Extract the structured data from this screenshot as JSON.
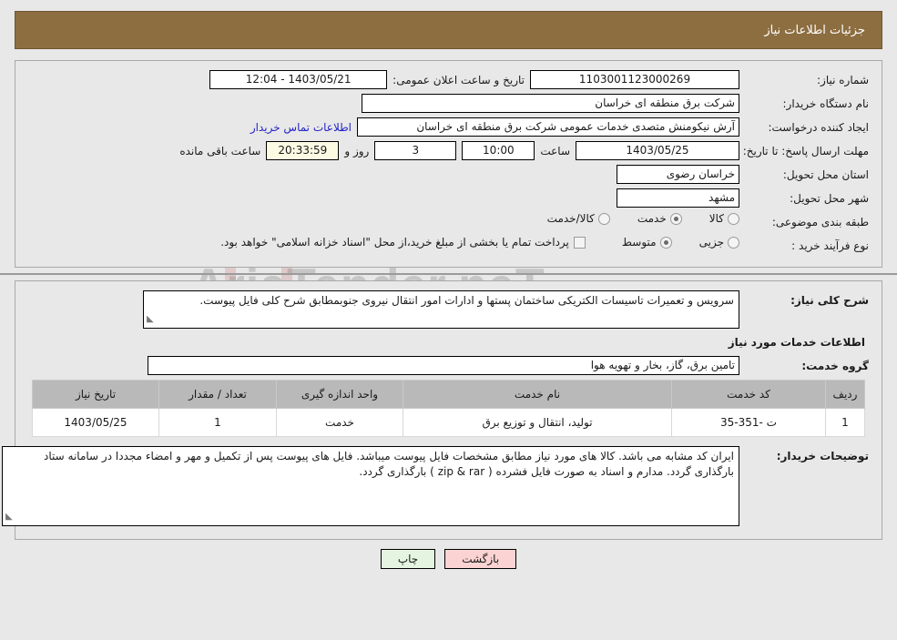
{
  "header": {
    "title": "جزئیات اطلاعات نیاز"
  },
  "watermark": {
    "text": "AriaTender.neT"
  },
  "form": {
    "need_number": {
      "label": "شماره نیاز:",
      "value": "1103001123000269"
    },
    "announce_datetime": {
      "label": "تاریخ و ساعت اعلان عمومی:",
      "value": "1403/05/21 - 12:04"
    },
    "buyer_org": {
      "label": "نام دستگاه خریدار:",
      "value": "شرکت برق منطقه ای خراسان"
    },
    "creator": {
      "label": "ایجاد کننده درخواست:",
      "value": "آرش نیکومنش متصدی خدمات عمومی شرکت برق منطقه ای خراسان",
      "contact_link": "اطلاعات تماس خریدار"
    },
    "deadline": {
      "label": "مهلت ارسال پاسخ: تا تاریخ:",
      "date": "1403/05/25",
      "time_label": "ساعت",
      "time": "10:00",
      "days": "3",
      "days_label": "روز و",
      "countdown": "20:33:59",
      "countdown_label": "ساعت باقی مانده"
    },
    "delivery_province": {
      "label": "استان محل تحویل:",
      "value": "خراسان رضوی"
    },
    "delivery_city": {
      "label": "شهر محل تحویل:",
      "value": "مشهد"
    },
    "category": {
      "label": "طبقه بندی موضوعی:",
      "options": [
        {
          "label": "کالا",
          "selected": false
        },
        {
          "label": "خدمت",
          "selected": true
        },
        {
          "label": "کالا/خدمت",
          "selected": false
        }
      ]
    },
    "purchase_type": {
      "label": "نوع فرآیند خرید :",
      "options": [
        {
          "label": "جزیی",
          "selected": false
        },
        {
          "label": "متوسط",
          "selected": true
        }
      ],
      "checkbox_label": "پرداخت تمام یا بخشی از مبلغ خرید،از محل \"اسناد خزانه اسلامی\" خواهد بود.",
      "checkbox_checked": false
    }
  },
  "description": {
    "label": "شرح کلی نیاز:",
    "value": "سرویس و تعمیرات تاسیسات الکتریکی ساختمان پستها و ادارات امور انتقال نیروی جنوبمطابق شرح کلی فایل پیوست."
  },
  "services_section": {
    "title": "اطلاعات خدمات مورد نیاز",
    "group": {
      "label": "گروه خدمت:",
      "value": "تامین برق، گاز، بخار و تهویه هوا"
    },
    "table": {
      "columns": [
        "ردیف",
        "کد خدمت",
        "نام خدمت",
        "واحد اندازه گیری",
        "تعداد / مقدار",
        "تاریخ نیاز"
      ],
      "rows": [
        {
          "index": "1",
          "code": "ت -351-35",
          "name": "تولید، انتقال و توزیع برق",
          "unit": "خدمت",
          "qty": "1",
          "date": "1403/05/25"
        }
      ]
    }
  },
  "buyer_notes": {
    "label": "توضیحات خریدار:",
    "value": "ایران کد مشابه می باشد. کالا های مورد نیاز مطابق مشخصات فایل پیوست میباشد. فایل های پیوست پس از تکمیل و مهر و امضاء مجددا در سامانه ستاد بارگذاری گردد. مدارم و اسناد به صورت فایل فشرده ( zip & rar ) بارگذاری گردد."
  },
  "footer": {
    "back_label": "بازگشت",
    "print_label": "چاپ"
  }
}
